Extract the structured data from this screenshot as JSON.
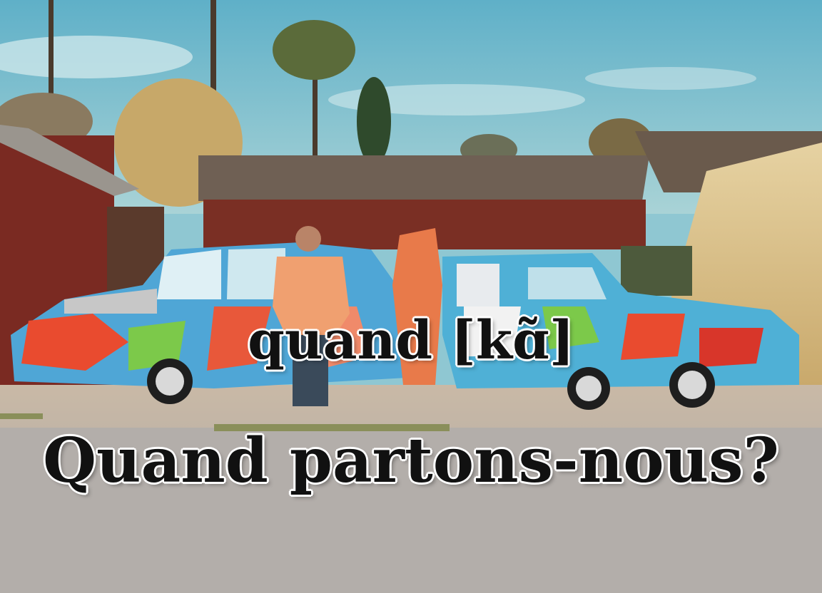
{
  "captions": {
    "word": "quand [kɑ̃]",
    "sentence": "Quand partons-nous?"
  },
  "colors": {
    "sky": "#7fc0cf",
    "barn": "#7a2f24",
    "roof": "#6a5a4c",
    "road": "#b7aea6",
    "dry_grass": "#d8c08a",
    "caption_fill": "#111111",
    "caption_outline": "#ffffff"
  }
}
